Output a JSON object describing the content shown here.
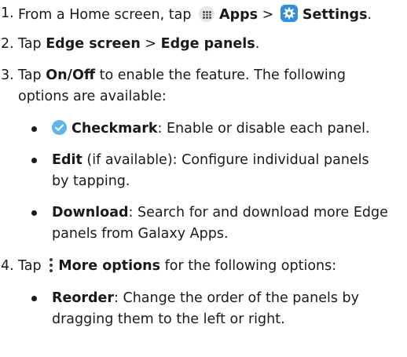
{
  "steps": [
    {
      "num": "1.",
      "text_a": "From a Home screen, tap",
      "apps_label": "Apps",
      "sep": ">",
      "settings_label": "Settings",
      "end": "."
    },
    {
      "num": "2.",
      "text_a": "Tap",
      "edge_screen": "Edge screen",
      "sep": ">",
      "edge_panels": "Edge panels",
      "end": "."
    },
    {
      "num": "3.",
      "text_a": "Tap",
      "onoff": "On/Off",
      "text_b": "to enable the feature. The following",
      "text_c": "options are available:"
    },
    {
      "num": "4.",
      "text_a": "Tap",
      "more_options": "More options",
      "text_b": "for the following options:"
    }
  ],
  "step3_bullets": [
    {
      "term": "Checkmark",
      "line1": ": Enable or disable each panel."
    },
    {
      "term": "Edit",
      "line1": " (if available): Configure individual panels",
      "line2": "by tapping."
    },
    {
      "term": "Download",
      "line1": ": Search for and download more Edge",
      "line2": "panels from Galaxy Apps."
    }
  ],
  "step4_bullets": [
    {
      "term": "Reorder",
      "line1": ": Change the order of the panels by",
      "line2": "dragging them to the left or right."
    }
  ],
  "icons": {
    "apps": "apps-grid-icon",
    "settings": "settings-gear-icon",
    "checkmark": "checkmark-circle-icon",
    "more": "more-options-vertical-dots-icon"
  },
  "colors": {
    "text": "#1a1a1a",
    "settings_icon_bg": "#2f8fe0",
    "checkmark_icon_bg": "#5ab5f0",
    "apps_icon_bg": "#e6e6e6"
  }
}
